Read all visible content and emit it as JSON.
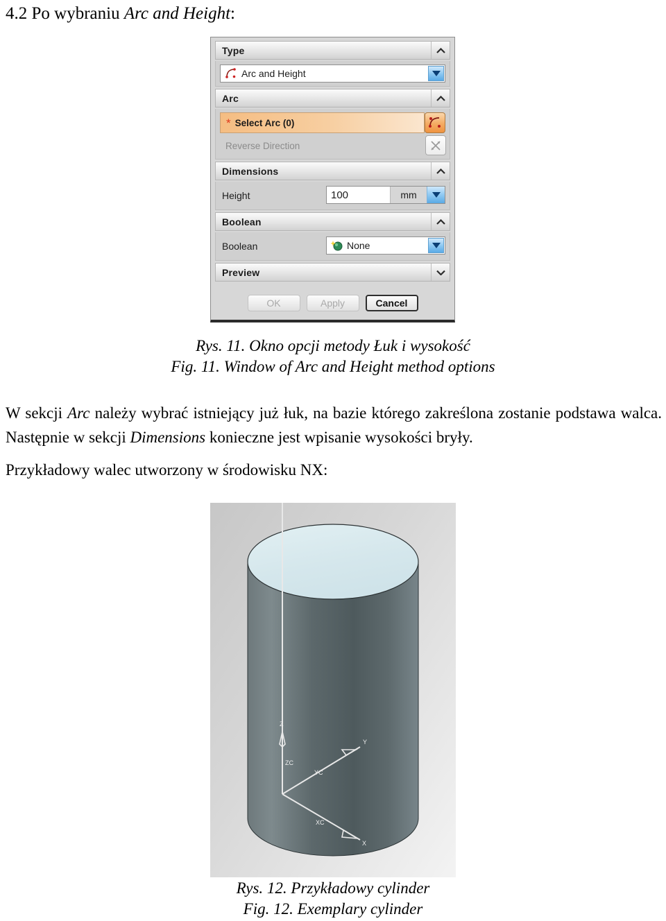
{
  "document": {
    "heading_number": "4.2",
    "heading_prefix": "Po wybraniu ",
    "heading_italic": "Arc and Height",
    "heading_suffix": ":",
    "paragraph_arc": {
      "part1": "W sekcji ",
      "italic1": "Arc",
      "part2": " należy wybrać istniejący już łuk, na bazie którego zakreślona zostanie podstawa walca. Następnie w sekcji ",
      "italic2": "Dimensions",
      "part3": "  konieczne jest wpisanie wysokości bryły."
    },
    "paragraph_example": "Przykładowy walec utworzony w środowisku NX:"
  },
  "figure11": {
    "caption_pl": "Rys. 11. Okno opcji metody Łuk i wysokość",
    "caption_en": "Fig. 11. Window of Arc and Height method options"
  },
  "figure12": {
    "caption_pl": "Rys. 12. Przykładowy cylinder",
    "caption_en": "Fig. 12. Exemplary cylinder"
  },
  "dialog": {
    "sections": {
      "type": {
        "header": "Type",
        "collapse_state": "expanded",
        "selected_option": "Arc and Height",
        "icon": "arc-and-height-icon"
      },
      "arc": {
        "header": "Arc",
        "collapse_state": "expanded",
        "select_arc_label": "Select Arc (0)",
        "select_arc_required_marker": "*",
        "select_arc_icon": "select-arc-icon",
        "reverse_direction_label": "Reverse Direction",
        "reverse_direction_icon": "reverse-direction-icon",
        "reverse_direction_enabled": "false"
      },
      "dimensions": {
        "header": "Dimensions",
        "collapse_state": "expanded",
        "height_label": "Height",
        "height_value": "100",
        "height_unit": "mm"
      },
      "boolean": {
        "header": "Boolean",
        "collapse_state": "expanded",
        "row_label": "Boolean",
        "selected_option": "None",
        "icon": "boolean-none-icon"
      },
      "preview": {
        "header": "Preview",
        "collapse_state": "collapsed"
      }
    },
    "buttons": {
      "ok": "OK",
      "apply": "Apply",
      "cancel": "Cancel"
    },
    "colors": {
      "highlight_orange": "#f5bd82",
      "dropdown_blue": "#5aaae6",
      "required_star_red": "#e03b1c",
      "panel_grey": "#d0d0d0"
    }
  },
  "cylinder_view": {
    "axes": {
      "z_label": "Z",
      "zc_label": "ZC",
      "y_label": "Y",
      "yc_label": "YC",
      "x_label": "X",
      "xc_label": "XC"
    },
    "colors": {
      "top_face": "#d6e8ec",
      "body_light": "#8f9c9f",
      "body_dark": "#4d595c",
      "background": "#dcdcdc"
    }
  }
}
